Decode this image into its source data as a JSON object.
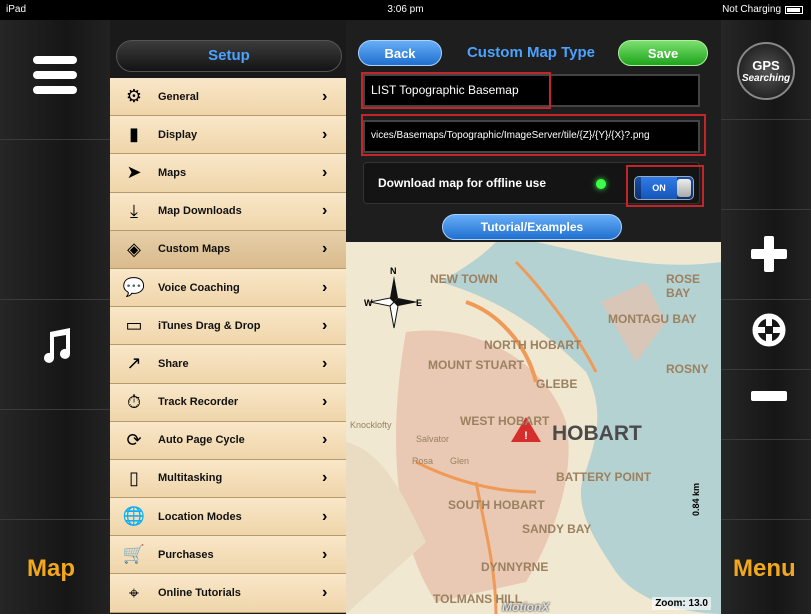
{
  "status_bar": {
    "device": "iPad",
    "time": "3:06 pm",
    "charging": "Not Charging"
  },
  "left_rail": {
    "music_icon": "music-note-icon",
    "bottom_label": "Map",
    "menu_icon": "hamburger-icon"
  },
  "right_rail": {
    "gps_badge_top": "GPS",
    "gps_badge_bottom": "Searching",
    "zoom_in_icon": "plus-icon",
    "locate_icon": "crosshair-icon",
    "zoom_out_icon": "minus-icon",
    "bottom_label": "Menu"
  },
  "setup": {
    "header": "Setup",
    "items": [
      {
        "label": "General",
        "icon": "gear-icon"
      },
      {
        "label": "Display",
        "icon": "ruler-icon"
      },
      {
        "label": "Maps",
        "icon": "arrow-icon"
      },
      {
        "label": "Map Downloads",
        "icon": "download-icon"
      },
      {
        "label": "Custom Maps",
        "icon": "map-tiles-icon",
        "selected": true
      },
      {
        "label": "Voice Coaching",
        "icon": "speech-icon"
      },
      {
        "label": "iTunes Drag & Drop",
        "icon": "folder-icon"
      },
      {
        "label": "Share",
        "icon": "share-icon"
      },
      {
        "label": "Track Recorder",
        "icon": "stopwatch-icon"
      },
      {
        "label": "Auto Page Cycle",
        "icon": "cycle-icon"
      },
      {
        "label": "Multitasking",
        "icon": "tablet-icon"
      },
      {
        "label": "Location Modes",
        "icon": "globe-icon"
      },
      {
        "label": "Purchases",
        "icon": "cart-icon"
      },
      {
        "label": "Online Tutorials",
        "icon": "map-help-icon"
      }
    ]
  },
  "custom_map": {
    "back_label": "Back",
    "title": "Custom Map Type",
    "save_label": "Save",
    "name_value": "LIST Topographic Basemap",
    "url_value": "vices/Basemaps/Topographic/ImageServer/tile/{Z}/{Y}/{X}?.png",
    "offline_label": "Download map for offline use",
    "toggle_label": "ON",
    "tutorial_label": "Tutorial/Examples"
  },
  "map": {
    "labels": [
      "NEW TOWN",
      "NORTH HOBART",
      "MOUNT STUART",
      "GLEBE",
      "WEST HOBART",
      "BATTERY POINT",
      "SOUTH HOBART",
      "SANDY BAY",
      "DYNNYRNE",
      "TOLMANS HILL",
      "MONTAGU BAY",
      "ROSNY",
      "ROSE BAY",
      "Knocklofty",
      "Salvator",
      "Rosa",
      "Glen"
    ],
    "city": "HOBART",
    "scale": "0.84 km",
    "zoom": "Zoom: 13.0",
    "brand": "MotionX",
    "compass_n": "N",
    "compass_w": "W",
    "compass_e": "E",
    "colors": {
      "land": "#f1e8d2",
      "water": "#b5d2d3",
      "urban": "#e7c0ad"
    }
  }
}
